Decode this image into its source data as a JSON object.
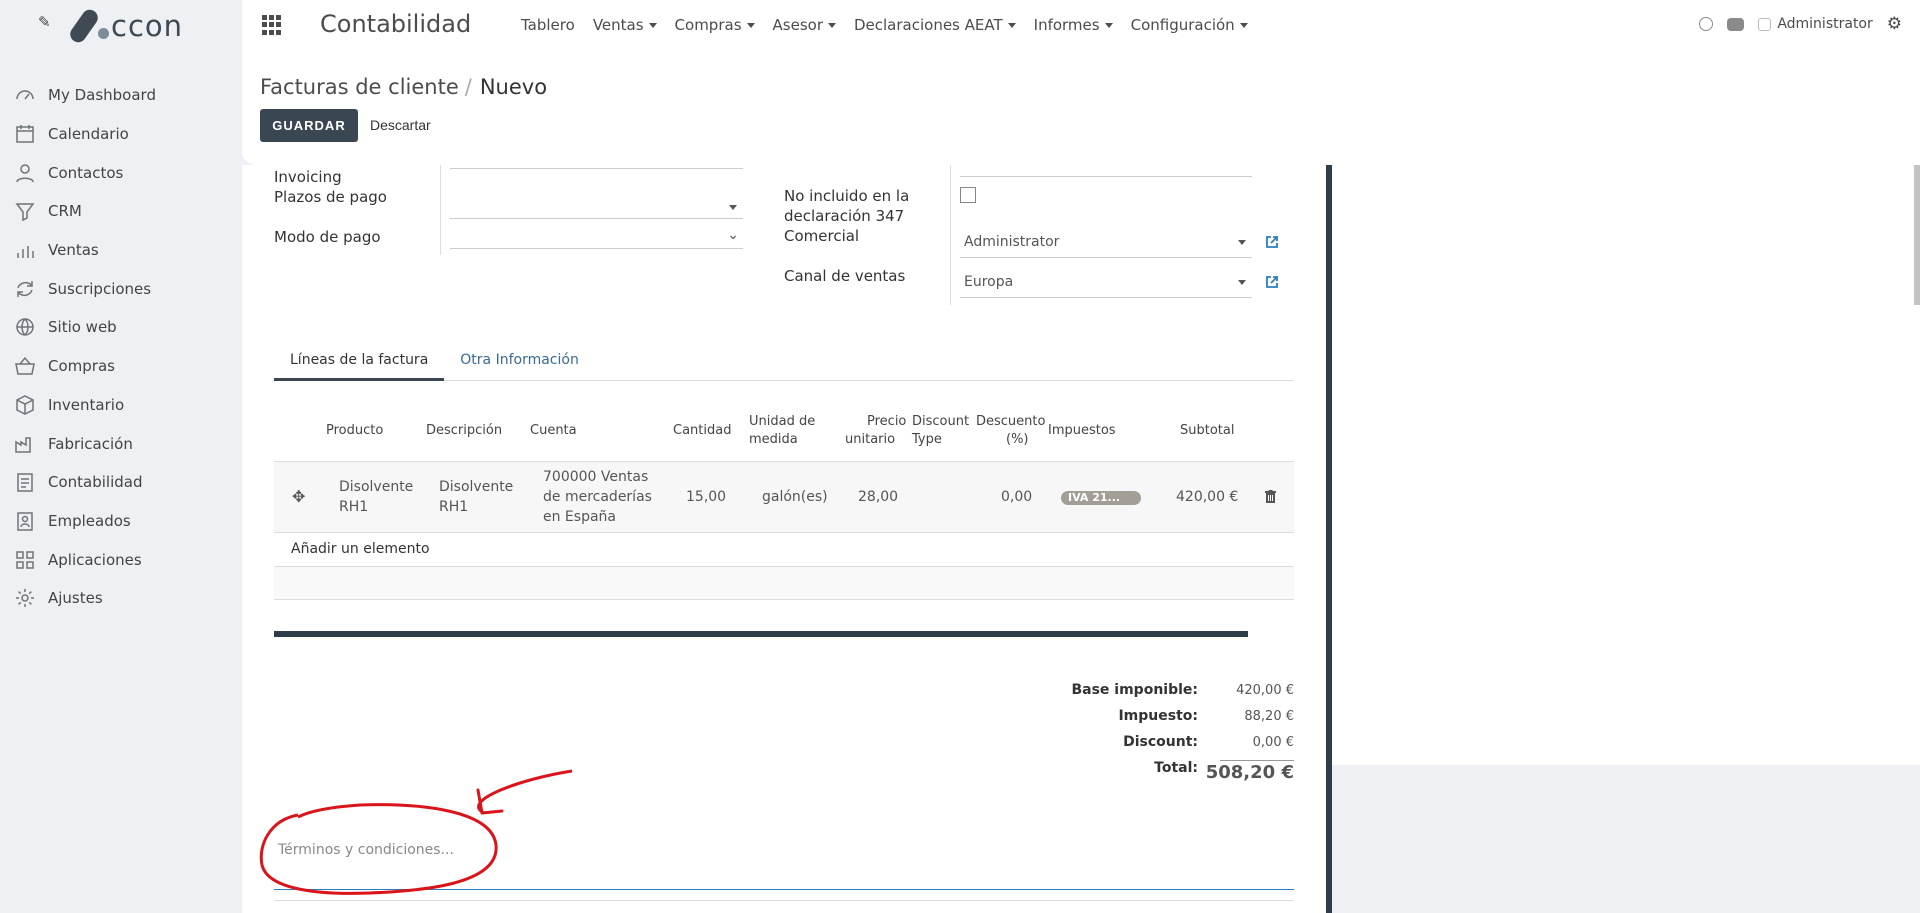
{
  "sidebar": {
    "logo_text": "ccon",
    "items": [
      {
        "label": "My Dashboard",
        "icon": "dashboard-icon"
      },
      {
        "label": "Calendario",
        "icon": "calendar-icon"
      },
      {
        "label": "Contactos",
        "icon": "person-icon"
      },
      {
        "label": "CRM",
        "icon": "funnel-icon"
      },
      {
        "label": "Ventas",
        "icon": "bar-chart-icon"
      },
      {
        "label": "Suscripciones",
        "icon": "refresh-icon"
      },
      {
        "label": "Sitio web",
        "icon": "globe-icon"
      },
      {
        "label": "Compras",
        "icon": "basket-icon"
      },
      {
        "label": "Inventario",
        "icon": "box-icon"
      },
      {
        "label": "Fabricación",
        "icon": "factory-icon"
      },
      {
        "label": "Contabilidad",
        "icon": "ledger-icon"
      },
      {
        "label": "Empleados",
        "icon": "employee-icon"
      },
      {
        "label": "Aplicaciones",
        "icon": "apps-grid-icon"
      },
      {
        "label": "Ajustes",
        "icon": "gear-icon"
      }
    ]
  },
  "topbar": {
    "app_title": "Contabilidad",
    "menu": [
      "Tablero",
      "Ventas",
      "Compras",
      "Asesor",
      "Declaraciones AEAT",
      "Informes",
      "Configuración"
    ],
    "user": "Administrator"
  },
  "control": {
    "breadcrumb_parent": "Facturas de cliente",
    "breadcrumb_sep": "/",
    "breadcrumb_current": "Nuevo",
    "save_label": "GUARDAR",
    "discard_label": "Descartar"
  },
  "form": {
    "invoicing_label": "Invoicing",
    "payment_terms_label": "Plazos de pago",
    "payment_mode_label": "Modo de pago",
    "no347_label_line1": "No incluido en la",
    "no347_label_line2": "declaración 347",
    "salesperson_label": "Comercial",
    "salesperson_value": "Administrator",
    "sales_channel_label": "Canal de ventas",
    "sales_channel_value": "Europa"
  },
  "tabs": [
    "Líneas de la factura",
    "Otra Información"
  ],
  "table": {
    "headers": {
      "product": "Producto",
      "description": "Descripción",
      "account": "Cuenta",
      "quantity": "Cantidad",
      "uom_1": "Unidad de",
      "uom_2": "medida",
      "price_1": "Precio",
      "price_2": "unitario",
      "dtype_1": "Discount",
      "dtype_2": "Type",
      "disc_1": "Descuento",
      "disc_2": "(%)",
      "taxes": "Impuestos",
      "subtotal": "Subtotal"
    },
    "row": {
      "product_1": "Disolvente",
      "product_2": "RH1",
      "description_1": "Disolvente",
      "description_2": "RH1",
      "account_1": "700000 Ventas",
      "account_2": "de mercaderías",
      "account_3": "en España",
      "quantity": "15,00",
      "uom": "galón(es)",
      "price": "28,00",
      "discount": "0,00",
      "tax": "IVA 21...",
      "subtotal": "420,00 €"
    },
    "add_line": "Añadir un elemento"
  },
  "totals": {
    "base_label": "Base imponible:",
    "base_value": "420,00 €",
    "tax_label": "Impuesto:",
    "tax_value": "88,20 €",
    "discount_label": "Discount:",
    "discount_value": "0,00 €",
    "total_label": "Total:",
    "total_value": "508,20 €"
  },
  "terms": {
    "placeholder": "Términos y condiciones..."
  },
  "colors": {
    "primary_button": "#3a4753",
    "link": "#2a7ec0",
    "annotation": "#d9141b"
  }
}
